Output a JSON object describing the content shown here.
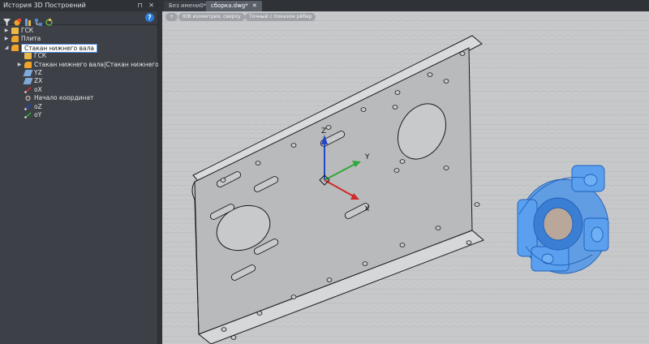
{
  "panel": {
    "title": "История 3D Построений",
    "pin_glyph": "⊓",
    "close_glyph": "✕",
    "help_label": "?"
  },
  "toolbar_icons": [
    "filter-icon",
    "add-part-icon",
    "link-icon",
    "hierarchy-icon",
    "refresh-icon"
  ],
  "tree": [
    {
      "label": "ГСК",
      "icon": "folder",
      "arrow": "▶",
      "indent": 0
    },
    {
      "label": "Плита",
      "icon": "part",
      "arrow": "▶",
      "indent": 0
    },
    {
      "label": "Стакан нижнего вала",
      "icon": "part",
      "arrow": "◢",
      "indent": 0,
      "selected": true
    },
    {
      "label": "ГСК",
      "icon": "folder",
      "arrow": "",
      "indent": 1
    },
    {
      "label": "Стакан нижнего вала|Стакан нижнего вала",
      "icon": "part",
      "arrow": "▶",
      "indent": 1
    },
    {
      "label": "YZ",
      "icon": "plane",
      "arrow": "",
      "indent": 1
    },
    {
      "label": "ZX",
      "icon": "plane",
      "arrow": "",
      "indent": 1
    },
    {
      "label": "oX",
      "icon": "axis-x",
      "arrow": "",
      "indent": 1
    },
    {
      "label": "Начало координат",
      "icon": "origin",
      "arrow": "",
      "indent": 1
    },
    {
      "label": "oZ",
      "icon": "axis-z",
      "arrow": "",
      "indent": 1
    },
    {
      "label": "oY",
      "icon": "axis-y",
      "arrow": "",
      "indent": 1
    }
  ],
  "tabs": [
    {
      "label": "Без имени0*",
      "active": false
    },
    {
      "label": "сборка.dwg*",
      "active": true
    }
  ],
  "viewport": {
    "tags": [
      "+",
      "ЮВ изометрия, сверху",
      "Точный с показом рёбер"
    ],
    "axis_labels": {
      "x": "X",
      "y": "Y",
      "z": "Z"
    }
  },
  "colors": {
    "axis_x": "#d02a2a",
    "axis_y": "#2fa83a",
    "axis_z": "#2446c8",
    "selection_blue": "#3b8fe8",
    "panel_bg": "#3d4046",
    "viewport_bg": "#c7c9cb"
  }
}
